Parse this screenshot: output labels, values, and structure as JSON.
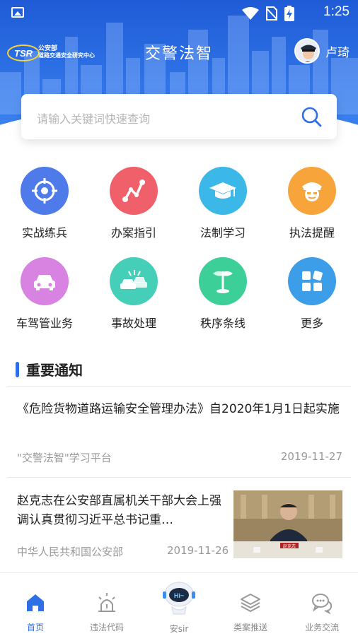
{
  "statusbar": {
    "time": "1:25"
  },
  "header": {
    "logo_line1": "公安部",
    "logo_line2": "道路交通安全研究中心",
    "logo_badge": "TSR",
    "app_title": "交警法智",
    "user_name": "卢琦"
  },
  "search": {
    "placeholder": "请输入关键词快速查询"
  },
  "features": [
    {
      "label": "实战练兵",
      "icon": "target-icon",
      "color": "#4f7bea"
    },
    {
      "label": "办案指引",
      "icon": "route-icon",
      "color": "#f0606a"
    },
    {
      "label": "法制学习",
      "icon": "graduation-cap-icon",
      "color": "#3cb8e8"
    },
    {
      "label": "执法提醒",
      "icon": "officer-icon",
      "color": "#f7a53b"
    },
    {
      "label": "车驾管业务",
      "icon": "car-icon",
      "color": "#d882e2"
    },
    {
      "label": "事故处理",
      "icon": "car-crash-icon",
      "color": "#46cfb8"
    },
    {
      "label": "秩序条线",
      "icon": "flag-icon",
      "color": "#3ccf98"
    },
    {
      "label": "更多",
      "icon": "grid-icon",
      "color": "#3c9de8"
    }
  ],
  "notices": {
    "title": "重要通知",
    "items": [
      {
        "headline": "《危险货物道路运输安全管理办法》自2020年1月1日起实施",
        "source": "\"交警法智\"学习平台",
        "date": "2019-11-27"
      },
      {
        "headline": "赵克志在公安部直属机关干部大会上强调认真贯彻习近平总书记重…",
        "source": "中华人民共和国公安部",
        "date": "2019-11-26",
        "thumb_text": "赵克志"
      }
    ]
  },
  "tabs": [
    {
      "label": "首页",
      "icon": "home-icon",
      "active": true
    },
    {
      "label": "违法代码",
      "icon": "alarm-icon",
      "active": false
    },
    {
      "label": "安sir",
      "icon": "robot-icon",
      "active": false
    },
    {
      "label": "类案推送",
      "icon": "layers-icon",
      "active": false
    },
    {
      "label": "业务交流",
      "icon": "chat-icon",
      "active": false
    }
  ],
  "colors": {
    "primary": "#2e6fe6",
    "header_top": "#1f5bd6",
    "muted_text": "#999999"
  }
}
